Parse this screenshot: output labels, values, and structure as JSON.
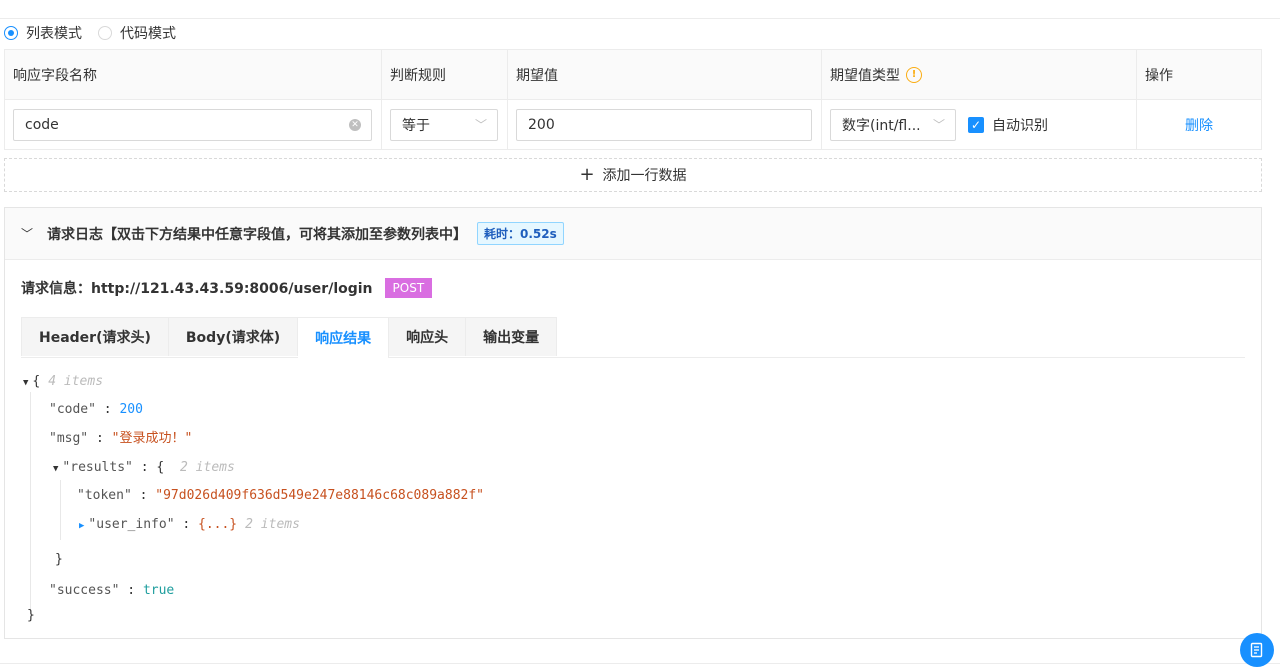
{
  "modes": {
    "list": "列表模式",
    "code": "代码模式",
    "selected": "list"
  },
  "table": {
    "headers": [
      "响应字段名称",
      "判断规则",
      "期望值",
      "期望值类型",
      "操作"
    ],
    "row": {
      "field": "code",
      "rule": "等于",
      "expected": "200",
      "type": "数字(int/fl...",
      "auto_detect_label": "自动识别",
      "auto_detect_checked": true,
      "action": "删除"
    },
    "add_row": "添加一行数据"
  },
  "log": {
    "title": "请求日志【双击下方结果中任意字段值，可将其添加至参数列表中】",
    "time": "耗时：0.52s",
    "request_label": "请求信息：http://121.43.43.59:8006/user/login",
    "method": "POST",
    "tabs": [
      "Header(请求头)",
      "Body(请求体)",
      "响应结果",
      "响应头",
      "输出变量"
    ],
    "active_tab": "响应结果"
  },
  "json": {
    "root_meta": "4 items",
    "code_key": "\"code\"",
    "code_val": "200",
    "msg_key": "\"msg\"",
    "msg_val": "\"登录成功！\"",
    "results_key": "\"results\"",
    "results_meta": "2 items",
    "token_key": "\"token\"",
    "token_val": "\"97d026d409f636d549e247e88146c68c089a882f\"",
    "user_info_key": "\"user_info\"",
    "user_info_val": "{...}",
    "user_info_meta": "2 items",
    "success_key": "\"success\"",
    "success_val": "true"
  },
  "icons": {
    "fab": "document-icon"
  },
  "colors": {
    "accent": "#1890ff",
    "method": "#d96ee1",
    "warning": "#faad14"
  }
}
